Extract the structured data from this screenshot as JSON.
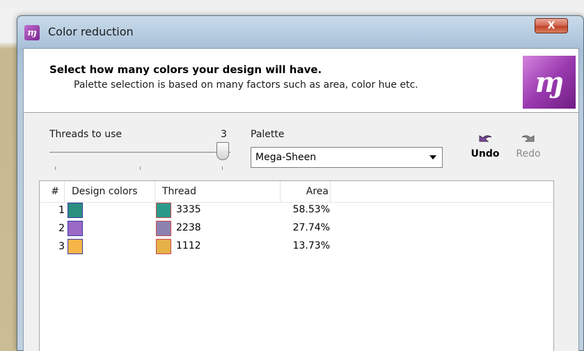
{
  "window": {
    "title": "Color reduction",
    "close_label": "X"
  },
  "header": {
    "title": "Select how many colors your design will have.",
    "subtitle": "Palette selection is based on many factors such as area, color hue etc."
  },
  "threads": {
    "label": "Threads to use",
    "value": "3",
    "slider_fraction": 1.0
  },
  "palette": {
    "label": "Palette",
    "selected": "Mega-Sheen"
  },
  "toolbar": {
    "undo_label": "Undo",
    "redo_label": "Redo"
  },
  "list": {
    "columns": [
      "#",
      "Design colors",
      "Thread",
      "Area"
    ],
    "rows": [
      {
        "num": "1",
        "design_color": "#2a8f7f",
        "thread_color": "#2a9a8a",
        "thread": "3335",
        "area": "58.53%"
      },
      {
        "num": "2",
        "design_color": "#9a6ac6",
        "thread_color": "#8c82b0",
        "thread": "2238",
        "area": "27.74%"
      },
      {
        "num": "3",
        "design_color": "#f7b548",
        "thread_color": "#e6b147",
        "thread": "1112",
        "area": "13.73%"
      }
    ]
  },
  "icons": {
    "app": "app-logo-icon",
    "undo": "undo-arrow-icon",
    "redo": "redo-arrow-icon"
  }
}
